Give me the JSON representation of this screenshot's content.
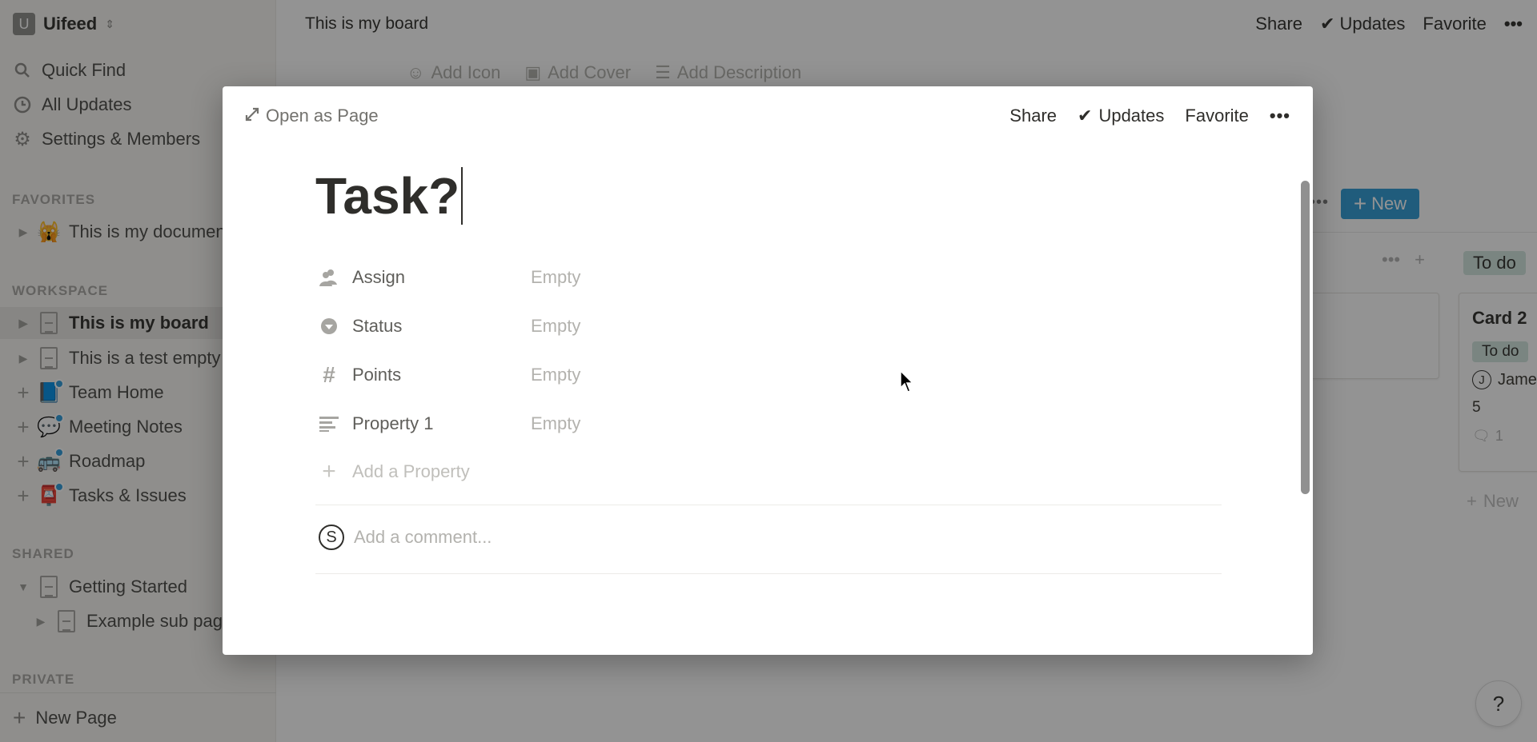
{
  "sidebar": {
    "workspace": {
      "initial": "U",
      "name": "Uifeed"
    },
    "nav": [
      {
        "label": "Quick Find",
        "icon": "search-icon"
      },
      {
        "label": "All Updates",
        "icon": "clock-icon"
      },
      {
        "label": "Settings & Members",
        "icon": "gear-icon"
      }
    ],
    "sections": {
      "favorites": "FAVORITES",
      "workspace": "WORKSPACE",
      "shared": "SHARED",
      "private": "PRIVATE"
    },
    "favorites": [
      {
        "label": "This is my document",
        "emoji": "🙀"
      }
    ],
    "workspace_items": [
      {
        "label": "This is my board",
        "icon": "page-icon",
        "active": true
      },
      {
        "label": "This is a test empty page",
        "icon": "page-icon"
      },
      {
        "label": "Team Home",
        "emoji": "📘"
      },
      {
        "label": "Meeting Notes",
        "emoji": "💬"
      },
      {
        "label": "Roadmap",
        "emoji": "🚌"
      },
      {
        "label": "Tasks & Issues",
        "emoji": "📮"
      }
    ],
    "shared_items": [
      {
        "label": "Getting Started",
        "icon": "page-icon",
        "expanded": true
      },
      {
        "label": "Example sub page",
        "icon": "page-icon",
        "child": true
      }
    ],
    "new_page_label": "New Page"
  },
  "topbar": {
    "title": "This is my board",
    "share": "Share",
    "updates": "Updates",
    "favorite": "Favorite",
    "more": "•••"
  },
  "page_meta": {
    "add_icon": "Add Icon",
    "add_cover": "Add Cover",
    "add_description": "Add Description"
  },
  "board": {
    "new_button": "New",
    "column_tag": "To do",
    "card": {
      "title": "Card 2",
      "status": "To do",
      "assignee_initial": "J",
      "assignee": "James",
      "points": "5",
      "comments": "1"
    },
    "add_new": "New"
  },
  "modal": {
    "open_as_page": "Open as Page",
    "share": "Share",
    "updates": "Updates",
    "favorite": "Favorite",
    "more": "•••",
    "title": "Task?",
    "properties": [
      {
        "name": "Assign",
        "value": "Empty",
        "icon": "people-icon"
      },
      {
        "name": "Status",
        "value": "Empty",
        "icon": "select-icon"
      },
      {
        "name": "Points",
        "value": "Empty",
        "icon": "number-icon"
      },
      {
        "name": "Property 1",
        "value": "Empty",
        "icon": "text-icon"
      }
    ],
    "add_property": "Add a Property",
    "comment": {
      "avatar_initial": "S",
      "placeholder": "Add a comment..."
    }
  },
  "help_button": "?"
}
